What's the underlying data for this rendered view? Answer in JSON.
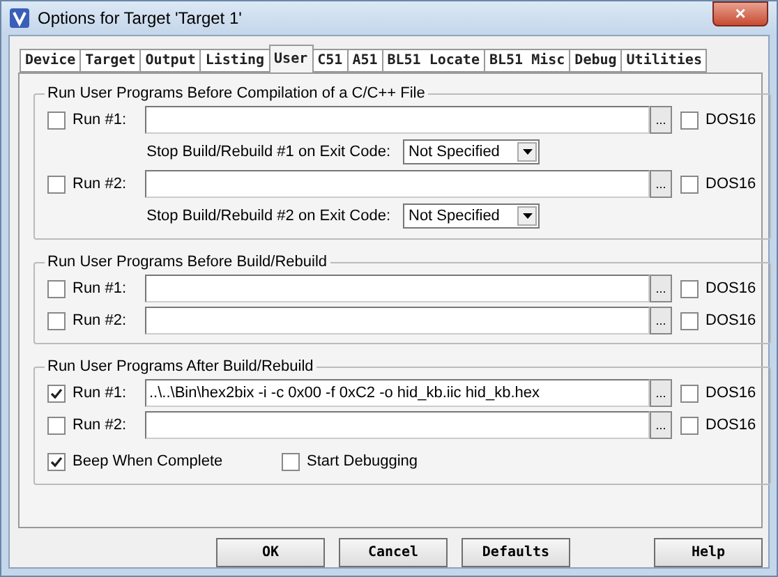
{
  "window": {
    "title": "Options for Target 'Target 1'",
    "close": "×"
  },
  "tabs": [
    {
      "label": "Device",
      "selected": false
    },
    {
      "label": "Target",
      "selected": false
    },
    {
      "label": "Output",
      "selected": false
    },
    {
      "label": "Listing",
      "selected": false
    },
    {
      "label": "User",
      "selected": true
    },
    {
      "label": "C51",
      "selected": false
    },
    {
      "label": "A51",
      "selected": false
    },
    {
      "label": "BL51 Locate",
      "selected": false
    },
    {
      "label": "BL51 Misc",
      "selected": false
    },
    {
      "label": "Debug",
      "selected": false
    },
    {
      "label": "Utilities",
      "selected": false
    }
  ],
  "groups": [
    {
      "title": "Run User Programs Before Compilation of a C/C++ File",
      "rows": [
        {
          "kind": "run",
          "label": "Run #1:",
          "checked": false,
          "value": "",
          "browse": "...",
          "dos16": {
            "label": "DOS16",
            "checked": false
          }
        },
        {
          "kind": "exit",
          "label": "Stop Build/Rebuild #1 on Exit Code:",
          "value": "Not Specified"
        },
        {
          "kind": "run",
          "label": "Run #2:",
          "checked": false,
          "value": "",
          "browse": "...",
          "dos16": {
            "label": "DOS16",
            "checked": false
          }
        },
        {
          "kind": "exit",
          "label": "Stop Build/Rebuild #2 on Exit Code:",
          "value": "Not Specified"
        }
      ]
    },
    {
      "title": "Run User Programs Before Build/Rebuild",
      "rows": [
        {
          "kind": "run",
          "label": "Run #1:",
          "checked": false,
          "value": "",
          "browse": "...",
          "dos16": {
            "label": "DOS16",
            "checked": false
          }
        },
        {
          "kind": "run",
          "label": "Run #2:",
          "checked": false,
          "value": "",
          "browse": "...",
          "dos16": {
            "label": "DOS16",
            "checked": false
          }
        }
      ]
    },
    {
      "title": "Run User Programs After Build/Rebuild",
      "rows": [
        {
          "kind": "run",
          "label": "Run #1:",
          "checked": true,
          "value": "..\\..\\Bin\\hex2bix -i -c 0x00 -f 0xC2 -o hid_kb.iic hid_kb.hex",
          "browse": "...",
          "dos16": {
            "label": "DOS16",
            "checked": false
          }
        },
        {
          "kind": "run",
          "label": "Run #2:",
          "checked": false,
          "value": "",
          "browse": "...",
          "dos16": {
            "label": "DOS16",
            "checked": false
          }
        },
        {
          "kind": "options",
          "items": [
            {
              "label": "Beep When Complete",
              "checked": true
            },
            {
              "label": "Start Debugging",
              "checked": false
            }
          ]
        }
      ]
    }
  ],
  "buttons": [
    "OK",
    "Cancel",
    "Defaults",
    "Help"
  ]
}
